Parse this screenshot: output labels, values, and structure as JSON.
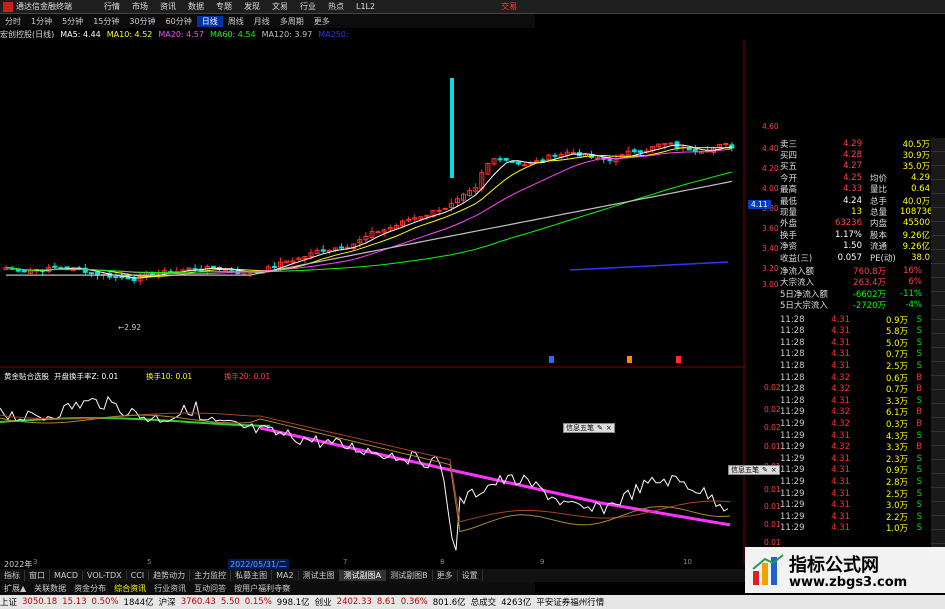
{
  "menubar": {
    "app_name": "通达信金融终端",
    "items": [
      "行情",
      "市场",
      "资讯",
      "数据",
      "专题",
      "发现",
      "文易",
      "行业",
      "热点",
      "L1L2"
    ],
    "right": "交易"
  },
  "toolbar": {
    "stock": "",
    "items": [
      "分时",
      "1分钟",
      "5分钟",
      "15分钟",
      "30分钟",
      "60分钟",
      "日线",
      "周线",
      "月线",
      "多周期",
      "更多"
    ],
    "selected": "日线"
  },
  "ma_legend": {
    "name": "宏创控股(日线)",
    "items": [
      {
        "label": "MA5: 4.44",
        "color": "#ffffff"
      },
      {
        "label": "MA10: 4.52",
        "color": "#ffff00"
      },
      {
        "label": "MA20: 4.57",
        "color": "#ff44ff"
      },
      {
        "label": "MA60: 4.54",
        "color": "#00ff00"
      },
      {
        "label": "MA120: 3.97",
        "color": "#c0c0c0"
      },
      {
        "label": "MA250:",
        "color": "#3333ff"
      }
    ]
  },
  "indicator_legend": {
    "items": [
      {
        "label": "黄金贴合选股",
        "color": "#ffffff"
      },
      {
        "label": "开盘换手率Z: 0.01",
        "color": "#ffffff"
      },
      {
        "label": "换手10: 0.01",
        "color": "#ffff00"
      },
      {
        "label": "换手20: 0.01",
        "color": "#ff4444"
      }
    ]
  },
  "price_axis": {
    "labels": [
      "4.60",
      "4.40",
      "4.20",
      "4.00",
      "3.80",
      "3.60",
      "3.40",
      "3.20",
      "3.00"
    ],
    "current": "4.11",
    "low_marker": "2.92"
  },
  "indicator_axis": {
    "labels": [
      "0.02",
      "0.02",
      "0.02",
      "0.01",
      "0.01",
      "0.01",
      "0.01",
      "0.01",
      "0.01"
    ]
  },
  "quote": {
    "rows": [
      {
        "l": "卖三",
        "v": "4.29",
        "l2": "",
        "v2": "40.5万",
        "vc": "#ff4444"
      },
      {
        "l": "买四",
        "v": "4.28",
        "l2": "",
        "v2": "30.9万",
        "vc": "#ff4444"
      },
      {
        "l": "买五",
        "v": "4.27",
        "l2": "",
        "v2": "35.0万",
        "vc": "#ff4444"
      },
      {
        "l": "今开",
        "v": "4.25",
        "l2": "均价",
        "v2": "4.29",
        "vc": "#ff4444"
      },
      {
        "l": "最高",
        "v": "4.33",
        "l2": "量比",
        "v2": "0.64",
        "vc": "#ff4444"
      },
      {
        "l": "最低",
        "v": "4.24",
        "l2": "总手",
        "v2": "40.0万",
        "vc": "#ffffff"
      },
      {
        "l": "现量",
        "v": "13",
        "l2": "总量",
        "v2": "108736",
        "vc": "#ffff00"
      },
      {
        "l": "外盘",
        "v": "63236",
        "l2": "内盘",
        "v2": "45500",
        "vc": "#ff4444"
      },
      {
        "l": "换手",
        "v": "1.17%",
        "l2": "股本",
        "v2": "9.26亿",
        "vc": "#ffffff"
      },
      {
        "l": "净资",
        "v": "1.50",
        "l2": "流通",
        "v2": "9.26亿",
        "vc": "#ffffff"
      },
      {
        "l": "收益(三)",
        "v": "0.057",
        "l2": "PE(动)",
        "v2": "38.0",
        "vc": "#ffffff"
      }
    ],
    "flows": [
      {
        "l": "净流入额",
        "v": "760.8万",
        "p": "16%",
        "c": "#ff4444"
      },
      {
        "l": "大宗流入",
        "v": "263.4万",
        "p": "6%",
        "c": "#ff4444"
      },
      {
        "l": "5日净流入额",
        "v": "-6602万",
        "p": "-11%",
        "c": "#00ff00"
      },
      {
        "l": "5日大宗流入",
        "v": "-2720万",
        "p": "-4%",
        "c": "#00ff00"
      }
    ]
  },
  "trades": [
    {
      "t": "11:28",
      "p": "4.31",
      "v": "0.9万",
      "bs": "S"
    },
    {
      "t": "11:28",
      "p": "4.31",
      "v": "5.8万",
      "bs": "S"
    },
    {
      "t": "11:28",
      "p": "4.31",
      "v": "5.0万",
      "bs": "S"
    },
    {
      "t": "11:28",
      "p": "4.31",
      "v": "0.7万",
      "bs": "S"
    },
    {
      "t": "11:28",
      "p": "4.31",
      "v": "2.5万",
      "bs": "S"
    },
    {
      "t": "11:28",
      "p": "4.32",
      "v": "0.6万",
      "bs": "B"
    },
    {
      "t": "11:28",
      "p": "4.32",
      "v": "0.7万",
      "bs": "B"
    },
    {
      "t": "11:28",
      "p": "4.31",
      "v": "3.3万",
      "bs": "S"
    },
    {
      "t": "11:29",
      "p": "4.32",
      "v": "6.1万",
      "bs": "B"
    },
    {
      "t": "11:29",
      "p": "4.32",
      "v": "0.3万",
      "bs": "B"
    },
    {
      "t": "11:29",
      "p": "4.31",
      "v": "4.3万",
      "bs": "S"
    },
    {
      "t": "11:29",
      "p": "4.32",
      "v": "3.3万",
      "bs": "B"
    },
    {
      "t": "11:29",
      "p": "4.31",
      "v": "2.3万",
      "bs": "S"
    },
    {
      "t": "11:29",
      "p": "4.31",
      "v": "0.9万",
      "bs": "S"
    },
    {
      "t": "11:29",
      "p": "4.31",
      "v": "2.8万",
      "bs": "S"
    },
    {
      "t": "11:29",
      "p": "4.31",
      "v": "2.5万",
      "bs": "S"
    },
    {
      "t": "11:29",
      "p": "4.31",
      "v": "3.0万",
      "bs": "S"
    },
    {
      "t": "11:29",
      "p": "4.31",
      "v": "2.2万",
      "bs": "S"
    },
    {
      "t": "11:29",
      "p": "4.31",
      "v": "1.0万",
      "bs": "S"
    }
  ],
  "bottomtabs": {
    "items": [
      "指标",
      "窗口",
      "MACD",
      "VOL-TDX",
      "CCI",
      "趋势动力",
      "主力监控",
      "私募主图",
      "MA2",
      "测试主图",
      "测试副图A",
      "测试副图B",
      "更多",
      "设置"
    ],
    "selected": "测试副图A"
  },
  "tabs2": {
    "items": [
      "扩展▲",
      "关联数据",
      "资金分布",
      "综合资讯",
      "行业资讯",
      "互动问答",
      "按用户福利寺察"
    ],
    "selected": "综合资讯"
  },
  "dates": {
    "year": "2022年",
    "date": "2022/05/31/二"
  },
  "dialogs": {
    "label": "信息五笔"
  },
  "statusbar": {
    "items": [
      {
        "t": "上证",
        "c": "#000"
      },
      {
        "t": "3050.18",
        "c": "#c00000"
      },
      {
        "t": "15.13",
        "c": "#c00000"
      },
      {
        "t": "0.50%",
        "c": "#c00000"
      },
      {
        "t": "1844亿",
        "c": "#000"
      },
      {
        "t": "沪深",
        "c": "#000"
      },
      {
        "t": "3760.43",
        "c": "#c00000"
      },
      {
        "t": "5.50",
        "c": "#c00000"
      },
      {
        "t": "0.15%",
        "c": "#c00000"
      },
      {
        "t": "998.1亿",
        "c": "#000"
      },
      {
        "t": "创业",
        "c": "#000"
      },
      {
        "t": "2402.33",
        "c": "#c00000"
      },
      {
        "t": "8.61",
        "c": "#c00000"
      },
      {
        "t": "0.36%",
        "c": "#c00000"
      },
      {
        "t": "801.6亿",
        "c": "#000"
      },
      {
        "t": "总成交",
        "c": "#000"
      },
      {
        "t": "4263亿",
        "c": "#000"
      },
      {
        "t": "平安证券福州行情",
        "c": "#000"
      }
    ]
  },
  "watermark": {
    "line1": "指标公式网",
    "line2": "www.zbgs3.com"
  },
  "colors": {
    "up": "#ff3030",
    "down": "#00e0e0",
    "bg": "#000000"
  }
}
